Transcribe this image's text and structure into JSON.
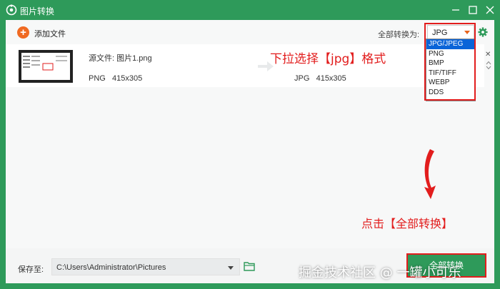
{
  "window": {
    "title": "图片转换"
  },
  "toolbar": {
    "add_file_label": "添加文件",
    "convert_all_label": "全部转换为:",
    "format_selected": "JPG"
  },
  "dropdown": {
    "options": [
      "JPG/JPEG",
      "PNG",
      "BMP",
      "TIF/TIFF",
      "WEBP",
      "DDS"
    ],
    "selected_index": 0
  },
  "file_row": {
    "source_label": "源文件: 图片1.png",
    "source_format": "PNG",
    "source_size": "415x305",
    "target_format": "JPG",
    "target_size": "415x305"
  },
  "annotations": {
    "dropdown_hint": "下拉选择【jpg】格式",
    "convert_hint": "点击【全部转换】"
  },
  "bottom": {
    "save_label": "保存至:",
    "save_path": "C:\\Users\\Administrator\\Pictures",
    "convert_all_button": "全部转换"
  },
  "watermark": "掘金技术社区 @ 一罐小可乐",
  "colors": {
    "brand_green": "#2e9a5a",
    "accent_orange": "#f06a22",
    "annotation_red": "#e21d1d",
    "selection_blue": "#0a64d8"
  }
}
